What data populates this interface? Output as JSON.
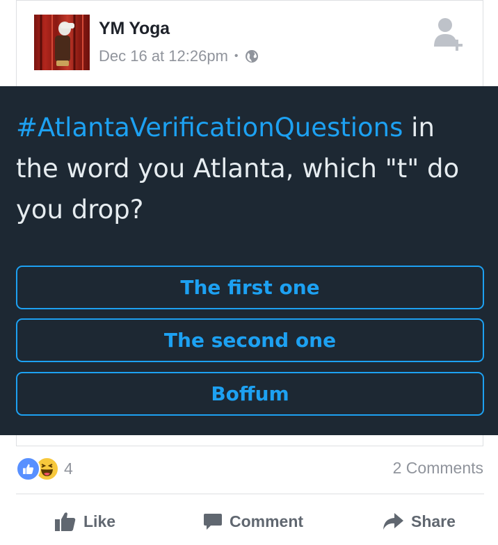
{
  "post": {
    "page_name": "YM Yoga",
    "timestamp": "Dec 16 at 12:26pm",
    "separator": "•",
    "avatar_icon": "page-avatar-image",
    "privacy_icon": "globe-icon",
    "add_friend_icon": "add-friend-icon"
  },
  "poll": {
    "hashtag": "#AtlantaVerificationQuestions",
    "question": " in the word you Atlanta, which \"t\" do you drop?",
    "choices": [
      "The first one",
      "The second one",
      "Boffum"
    ],
    "background_color": "#1d2833",
    "accent_color": "#1da1f2"
  },
  "engagement": {
    "reaction_icons": [
      "like-reaction-icon",
      "haha-reaction-icon"
    ],
    "reaction_count": "4",
    "comments": "2 Comments"
  },
  "actions": {
    "like": "Like",
    "comment": "Comment",
    "share": "Share"
  }
}
